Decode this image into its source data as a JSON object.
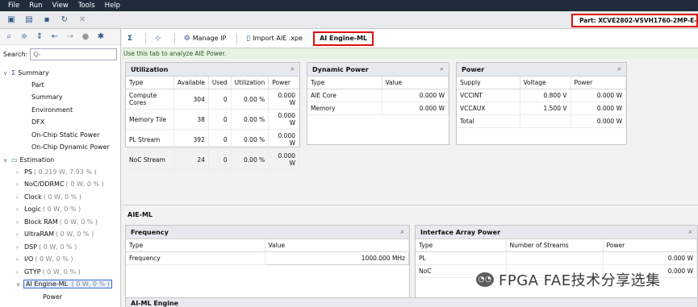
{
  "menu": [
    "File",
    "Run",
    "View",
    "Tools",
    "Help"
  ],
  "part": "Part: XCVE2802-VSVH1760-2MP-E-S",
  "left": {
    "search_label": "Search:",
    "search_placeholder": "Q-",
    "tree": {
      "summary": "Summary",
      "summary_items": [
        "Part",
        "Summary",
        "Environment",
        "DFX",
        "On-Chip Static Power",
        "On-Chip Dynamic Power"
      ],
      "estimation": "Estimation",
      "est_items": [
        {
          "label": "PS",
          "detail": "( 0.219 W, 7.93 % )"
        },
        {
          "label": "NoC/DDRMC",
          "detail": "( 0 W, 0 % )"
        },
        {
          "label": "Clock",
          "detail": "( 0 W, 0 % )"
        },
        {
          "label": "Logic",
          "detail": "( 0 W, 0 % )"
        },
        {
          "label": "Block RAM",
          "detail": "( 0 W, 0 % )"
        },
        {
          "label": "UltraRAM",
          "detail": "( 0 W, 0 % )"
        },
        {
          "label": "DSP",
          "detail": "( 0 W, 0 % )"
        },
        {
          "label": "I/O",
          "detail": "( 0 W, 0 % )"
        },
        {
          "label": "GTYP",
          "detail": "( 0 W, 0 % )"
        },
        {
          "label": "AI Engine-ML",
          "detail": "( 0 W, 0 % )"
        }
      ],
      "power": "Power"
    }
  },
  "tabs": {
    "manage_ip": "Manage IP",
    "import_aie": "Import AIE .xpe",
    "ai_engine_ml": "AI Engine-ML"
  },
  "hint": "Use this tab to analyze AIE Power.",
  "utilization": {
    "title": "Utilization",
    "headers": [
      "Type",
      "Available",
      "Used",
      "Utilization",
      "Power"
    ],
    "rows": [
      [
        "Compute Cores",
        "304",
        "0",
        "0.00 %",
        "0.000 W"
      ],
      [
        "Memory Tile",
        "38",
        "0",
        "0.00 %",
        "0.000 W"
      ],
      [
        "PL Stream",
        "392",
        "0",
        "0.00 %",
        "0.000 W"
      ],
      [
        "NoC Stream",
        "24",
        "0",
        "0.00 %",
        "0.000 W"
      ]
    ]
  },
  "dynamic": {
    "title": "Dynamic Power",
    "headers": [
      "Type",
      "Value"
    ],
    "rows": [
      [
        "AIE Core",
        "0.000 W"
      ],
      [
        "Memory",
        "0.000 W"
      ]
    ]
  },
  "power": {
    "title": "Power",
    "headers": [
      "Supply",
      "Voltage",
      "Power"
    ],
    "rows": [
      [
        "VCCINT",
        "0.800 V",
        "0.000 W"
      ],
      [
        "VCCAUX",
        "1.500 V",
        "0.000 W"
      ],
      [
        "Total",
        "",
        "0.000 W"
      ]
    ]
  },
  "aie_ml_label": "AIE-ML",
  "frequency": {
    "title": "Frequency",
    "headers": [
      "Type",
      "Value"
    ],
    "rows": [
      [
        "Frequency",
        "1000.000 MHz"
      ]
    ]
  },
  "interface": {
    "title": "Interface Array Power",
    "headers": [
      "Type",
      "Number of Streams",
      "Power"
    ],
    "rows": [
      [
        "PL",
        "",
        "0.000 W"
      ],
      [
        "NoC",
        "",
        "0.000 W"
      ]
    ]
  },
  "ai_ml_engine_label": "AI-ML Engine",
  "watermark": "FPGA FAE技术分享选集"
}
